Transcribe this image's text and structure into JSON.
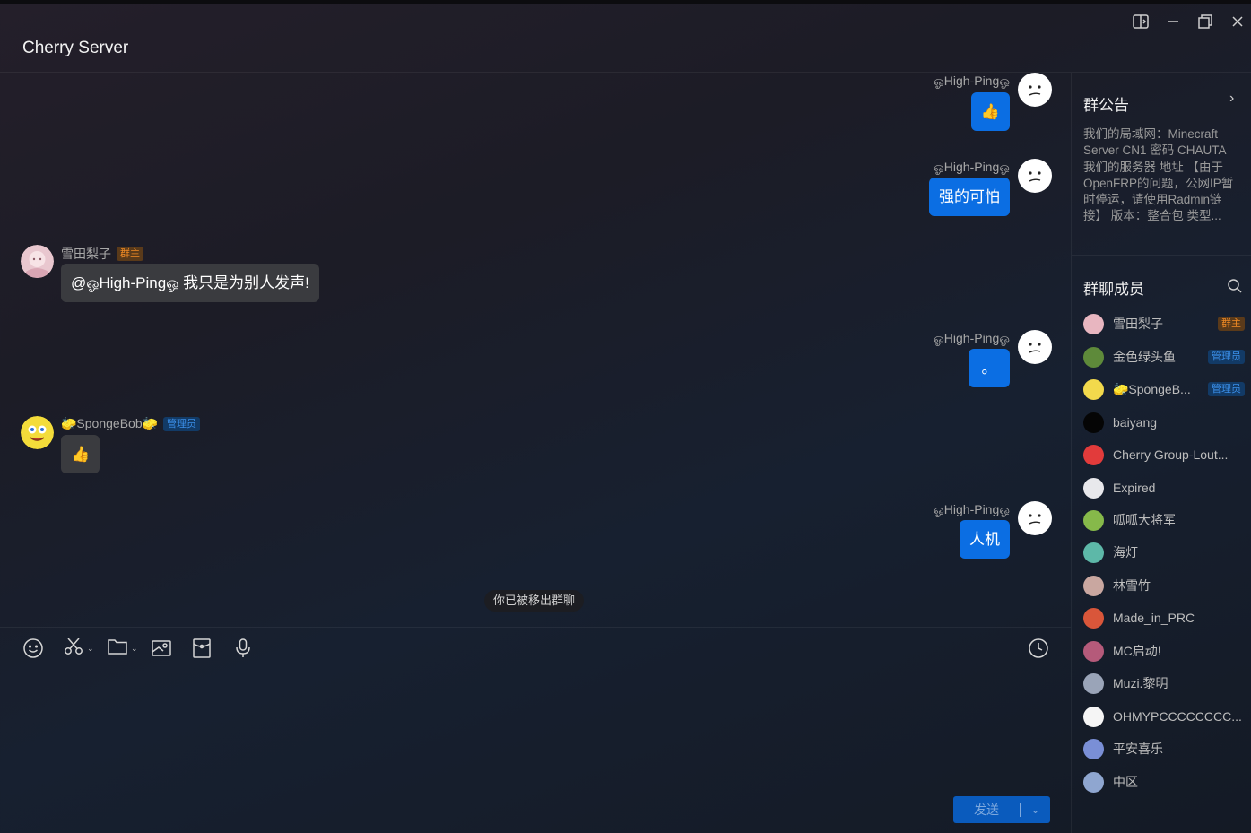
{
  "window": {
    "title": "Cherry Server"
  },
  "messages": [
    {
      "side": "right",
      "sender": "ஓHigh-Pingஓ",
      "content": "👍"
    },
    {
      "side": "right",
      "sender": "ஓHigh-Pingஓ",
      "content": "强的可怕"
    },
    {
      "side": "left",
      "sender": "雪田梨子",
      "badge": "群主",
      "content": "@ஓHigh-Pingஓ 我只是为别人发声!"
    },
    {
      "side": "right",
      "sender": "ஓHigh-Pingஓ",
      "content": "。"
    },
    {
      "side": "left",
      "sender": "🧽SpongeBob🧽",
      "badge": "管理员",
      "content": "👍"
    },
    {
      "side": "right",
      "sender": "ஓHigh-Pingஓ",
      "content": "人机"
    }
  ],
  "system_note": "你已被移出群聊",
  "composer": {
    "send_label": "发送"
  },
  "sidebar": {
    "notice_title": "群公告",
    "notice_text": "我们的局域网：Minecraft Server CN1 密码 CHAUTA 我们的服务器 地址 【由于OpenFRP的问题，公网IP暂时停运，请使用Radmin链接】 版本：整合包 类型...",
    "members_title": "群聊成员",
    "members": [
      {
        "name": "雪田梨子",
        "badge": "群主",
        "color": "#e8b6c0"
      },
      {
        "name": "金色绿头鱼",
        "badge": "管理员",
        "color": "#5e8a3a"
      },
      {
        "name": "🧽SpongeB...",
        "badge": "管理员",
        "color": "#f2d94c"
      },
      {
        "name": "baiyang",
        "badge": "",
        "color": "#050505"
      },
      {
        "name": "Cherry Group-Lout...",
        "badge": "",
        "color": "#e23b3b"
      },
      {
        "name": "Expired",
        "badge": "",
        "color": "#e8e8ec"
      },
      {
        "name": "呱呱大将军",
        "badge": "",
        "color": "#86b94a"
      },
      {
        "name": "海灯",
        "badge": "",
        "color": "#5db8a8"
      },
      {
        "name": "林雪竹",
        "badge": "",
        "color": "#c9a7a0"
      },
      {
        "name": "Made_in_PRC",
        "badge": "",
        "color": "#d9563a"
      },
      {
        "name": "MC启动!",
        "badge": "",
        "color": "#b55a7a"
      },
      {
        "name": "Muzi.黎明",
        "badge": "",
        "color": "#9aa4b8"
      },
      {
        "name": "OHMYPCCCCCCCC...",
        "badge": "",
        "color": "#f5f5f5"
      },
      {
        "name": "平安喜乐",
        "badge": "",
        "color": "#7a8fd6"
      },
      {
        "name": "中区",
        "badge": "",
        "color": "#8fa6d0"
      }
    ]
  },
  "colors": {
    "accent": "#0b6ee3",
    "owner_badge": "#f08a24",
    "admin_badge": "#3a8ee8"
  }
}
